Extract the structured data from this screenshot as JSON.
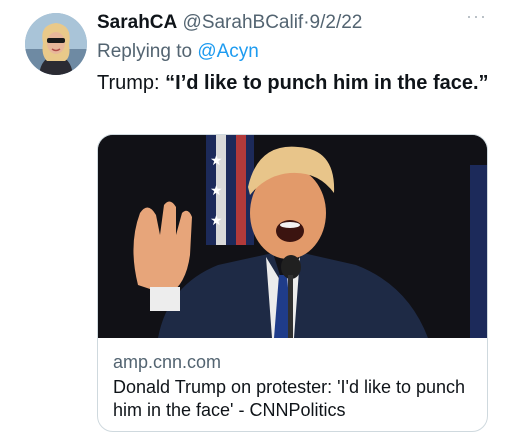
{
  "tweet": {
    "author": {
      "display_name": "SarahCA",
      "handle": "@SarahBCalif",
      "separator": "·",
      "date": "9/2/22",
      "avatar_icon": "profile-photo"
    },
    "more_icon": "more-options-icon",
    "reply": {
      "prefix": "Replying to",
      "handle": "@Acyn"
    },
    "text": {
      "lead": "Trump: ",
      "quote": "“I’d like to punch him in the face.”"
    },
    "card": {
      "image_description_icon": "news-photo",
      "domain": "amp.cnn.com",
      "title": "Donald Trump on protester: 'I'd like to punch him in the face' - CNNPolitics"
    },
    "colors": {
      "link": "#1d9bf0",
      "muted": "#536471",
      "text": "#0f1419",
      "border": "#cfd9de"
    }
  }
}
